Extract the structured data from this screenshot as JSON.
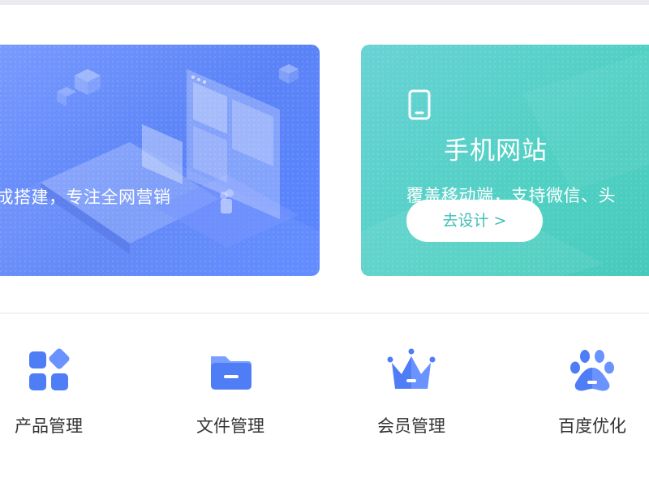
{
  "banner_cards": [
    {
      "text": "完成搭建，专注全网营销",
      "accent_color": "#5b83f7"
    },
    {
      "title": "手机网站",
      "text": "覆盖移动端，支持微信、头",
      "button_label": "去设计 >",
      "accent_color": "#4fd0c2",
      "icon": "mobile-phone-icon"
    }
  ],
  "features": [
    {
      "label": "产品管理",
      "icon": "grid-squares-icon"
    },
    {
      "label": "文件管理",
      "icon": "folder-icon"
    },
    {
      "label": "会员管理",
      "icon": "crown-icon"
    },
    {
      "label": "百度优化",
      "icon": "paw-icon"
    }
  ],
  "colors": {
    "icon_blue": "#4f7df6",
    "button_text": "#3ebfb5",
    "label_text": "#333333"
  }
}
